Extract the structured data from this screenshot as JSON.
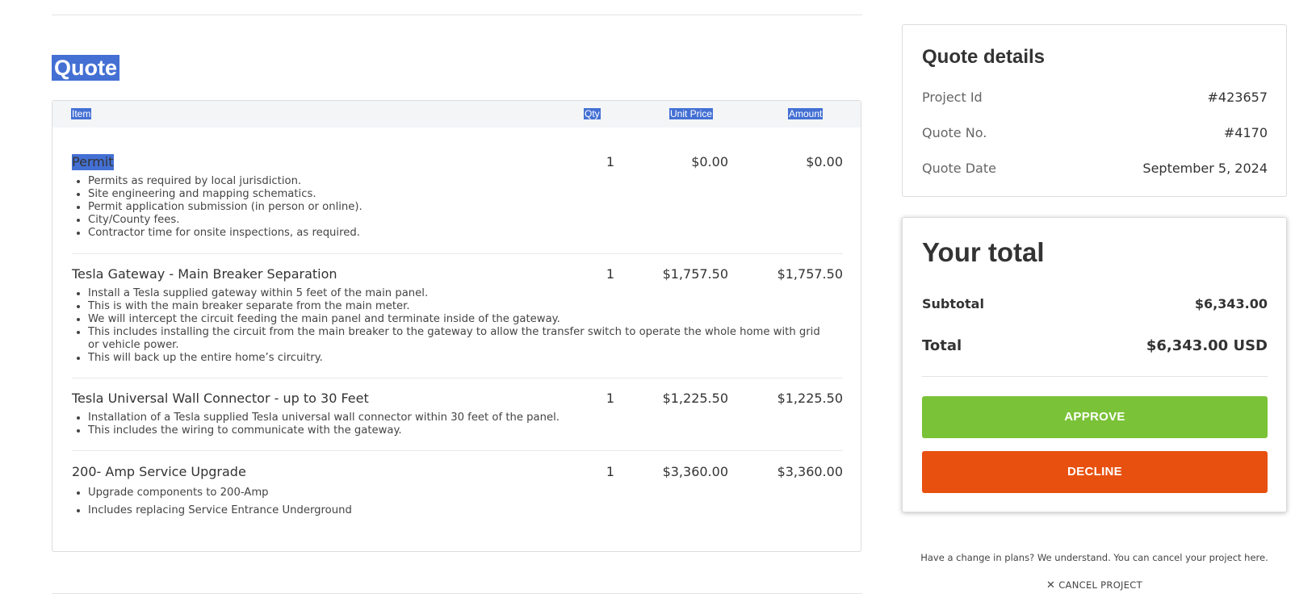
{
  "page": {
    "title": "Quote"
  },
  "table": {
    "headers": {
      "item": "Item",
      "qty": "Qty",
      "unit_price": "Unit Price",
      "amount": "Amount"
    },
    "rows": [
      {
        "name": "Permit",
        "qty": "1",
        "unit_price": "$0.00",
        "amount": "$0.00",
        "bullets": [
          "Permits as required by local jurisdiction.",
          "Site engineering and mapping schematics.",
          "Permit application submission (in person or online).",
          "City/County fees.",
          "Contractor time for onsite inspections, as required."
        ]
      },
      {
        "name": "Tesla Gateway - Main Breaker Separation",
        "qty": "1",
        "unit_price": "$1,757.50",
        "amount": "$1,757.50",
        "bullets": [
          "Install a Tesla supplied gateway within 5 feet of the main panel.",
          "This is with the main breaker separate from the main meter.",
          "We will intercept the circuit feeding the main panel and terminate inside of the gateway.",
          "This includes installing the circuit from the main breaker to the gateway to allow the transfer switch to operate the whole home with grid or vehicle power.",
          "This will back up the entire home’s circuitry."
        ]
      },
      {
        "name": "Tesla Universal Wall Connector - up to 30 Feet",
        "qty": "1",
        "unit_price": "$1,225.50",
        "amount": "$1,225.50",
        "bullets": [
          "Installation of a Tesla supplied Tesla universal wall connector within 30 feet of the panel.",
          "This includes the wiring to communicate with the gateway."
        ]
      },
      {
        "name": "200- Amp Service Upgrade",
        "qty": "1",
        "unit_price": "$3,360.00",
        "amount": "$3,360.00",
        "bullets": [
          "Upgrade components to 200-Amp",
          "Includes replacing Service Entrance Underground"
        ]
      }
    ]
  },
  "details": {
    "title": "Quote details",
    "project_id_label": "Project Id",
    "project_id_value": "#423657",
    "quote_no_label": "Quote No.",
    "quote_no_value": "#4170",
    "quote_date_label": "Quote Date",
    "quote_date_value": "September 5, 2024"
  },
  "total": {
    "title": "Your total",
    "subtotal_label": "Subtotal",
    "subtotal_value": "$6,343.00",
    "total_label": "Total",
    "total_value": "$6,343.00 USD",
    "approve_label": "APPROVE",
    "decline_label": "DECLINE"
  },
  "cancel": {
    "note": "Have a change in plans? We understand. You can cancel your project here.",
    "link_label": "CANCEL PROJECT",
    "icon": "close-icon"
  },
  "colors": {
    "selection": "#4470d4",
    "approve": "#7ac237",
    "decline": "#e8500f"
  }
}
